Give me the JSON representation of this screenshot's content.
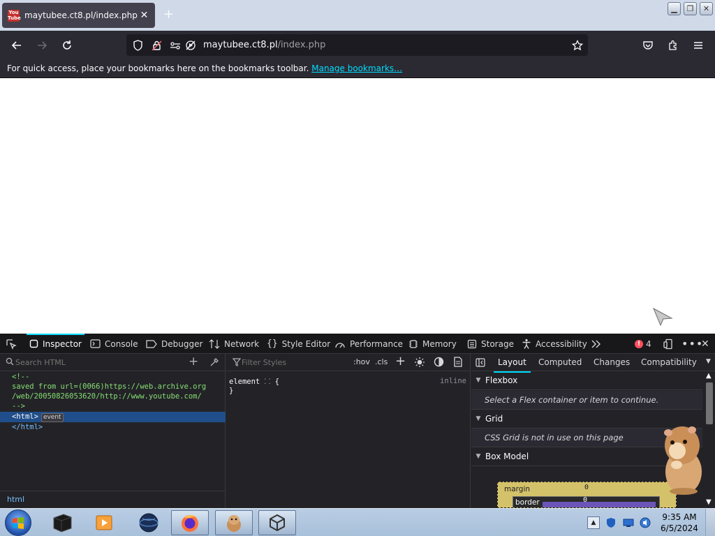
{
  "tab": {
    "title": "maytubee.ct8.pl/index.php",
    "favicon_text_1": "You",
    "favicon_text_2": "Tube"
  },
  "nav": {
    "url_host": "maytubee.ct8.pl",
    "url_path": "/index.php"
  },
  "bookmarks_bar": {
    "message": "For quick access, place your bookmarks here on the bookmarks toolbar.",
    "link": "Manage bookmarks…"
  },
  "devtools": {
    "tabs": [
      "Inspector",
      "Console",
      "Debugger",
      "Network",
      "Style Editor",
      "Performance",
      "Memory",
      "Storage",
      "Accessibility"
    ],
    "error_count": "4",
    "html_search_placeholder": "Search HTML",
    "markup": {
      "line1": "<!--",
      "line2": "saved from url=(0066)https://web.archive.org",
      "line3": "/web/20050826053620/http://www.youtube.com/",
      "line4": "-->",
      "line5": "<html>",
      "badge": "event",
      "line6": "</html>"
    },
    "breadcrumb": "html",
    "rules": {
      "filter_placeholder": "Filter Styles",
      "hov": ":hov",
      "cls": ".cls",
      "element_selector": "element",
      "open_brace": "{",
      "close_brace": "}",
      "inline_label": "inline"
    },
    "layout": {
      "tabs": [
        "Layout",
        "Computed",
        "Changes",
        "Compatibility"
      ],
      "flexbox_title": "Flexbox",
      "flexbox_msg": "Select a Flex container or item to continue.",
      "grid_title": "Grid",
      "grid_msg": "CSS Grid is not in use on this page",
      "boxmodel_title": "Box Model",
      "margin_label": "margin",
      "margin_value": "0",
      "border_label": "border",
      "border_value": "0"
    }
  },
  "taskbar": {
    "time": "9:35 AM",
    "date": "6/5/2024"
  },
  "colors": {
    "chrome_dark": "#2b2a33",
    "urlbar": "#1c1b22",
    "accent": "#00ddff",
    "selection": "#204e8a",
    "comment_green": "#86de74",
    "margin_box": "#d4c26a",
    "border_box": "#2a2a2a",
    "content_box": "#6b55b8"
  }
}
